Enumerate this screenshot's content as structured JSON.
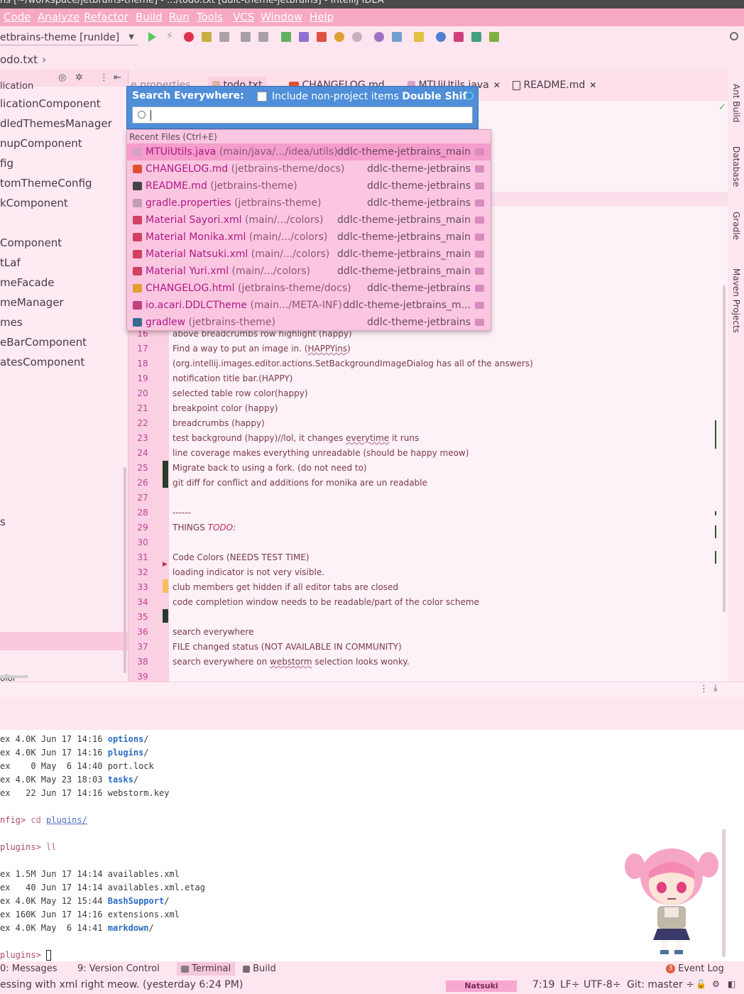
{
  "window": {
    "title": "ns [~/workspace/jetbrains-theme] - .../todo.txt [ddlc-theme-jetbrains] - IntelliJ IDEA"
  },
  "menu": [
    "Code",
    "Analyze",
    "Refactor",
    "Build",
    "Run",
    "Tools",
    "VCS",
    "Window",
    "Help"
  ],
  "toolbar": {
    "run_config": "etbrains-theme [runIde]"
  },
  "navbar": {
    "breadcrumb": "odo.txt"
  },
  "project_tree": {
    "items": [
      "lication",
      "licationComponent",
      "dledThemesManager",
      "nupComponent",
      "fig",
      "tomThemeConfig",
      "kComponent",
      "Component",
      "tLaf",
      "meFacade",
      "meManager",
      "mes",
      "eBarComponent",
      "atesComponent",
      "s",
      "olor"
    ]
  },
  "editor_tabs": [
    {
      "label": "e.properties"
    },
    {
      "label": "todo.txt"
    },
    {
      "label": "CHANGELOG.md"
    },
    {
      "label": "MTUiUtils.java"
    },
    {
      "label": "README.md"
    }
  ],
  "editor": {
    "lines": [
      {
        "n": "16",
        "text": "above breadcrumbs row highlight (happy)"
      },
      {
        "n": "17",
        "text": "Find a way to put an image in. (HAPPYins)"
      },
      {
        "n": "18",
        "text": "(org.intellij.images.editor.actions.SetBackgroundImageDialog has all of the answers)"
      },
      {
        "n": "19",
        "text": "notification title bar.(HAPPY)"
      },
      {
        "n": "20",
        "text": "selected table row color(happy)"
      },
      {
        "n": "21",
        "text": "breakpoint color (happy)"
      },
      {
        "n": "22",
        "text": "breadcrumbs (happy)"
      },
      {
        "n": "23",
        "text": "test background (happy)//lol, it changes everytime it runs"
      },
      {
        "n": "24",
        "text": "line coverage makes everything unreadable (should be happy meow)"
      },
      {
        "n": "25",
        "text": "Migrate back to using a fork. (do not need to)"
      },
      {
        "n": "26",
        "text": "git diff for conflict and additions for monika are un readable"
      },
      {
        "n": "27",
        "text": ""
      },
      {
        "n": "28",
        "text": "------"
      },
      {
        "n": "29",
        "text": "THINGS TODO:"
      },
      {
        "n": "30",
        "text": ""
      },
      {
        "n": "31",
        "text": "Code Colors (NEEDS TEST TIME)"
      },
      {
        "n": "32",
        "text": "loading indicator is not very visible."
      },
      {
        "n": "33",
        "text": "club members get hidden if all editor tabs are closed"
      },
      {
        "n": "34",
        "text": "code completion window needs to be readable/part of the color scheme"
      },
      {
        "n": "35",
        "text": ""
      },
      {
        "n": "36",
        "text": "search everywhere"
      },
      {
        "n": "37",
        "text": "FILE changed status (NOT AVAILABLE IN COMMUNITY)"
      },
      {
        "n": "38",
        "text": "search everywhere on webstorm selection looks wonky."
      },
      {
        "n": "39",
        "text": ""
      }
    ]
  },
  "right_tool_windows": [
    "Ant Build",
    "Database",
    "Gradle",
    "Maven Projects"
  ],
  "search_everywhere": {
    "title": "Search Everywhere:",
    "checkbox_label": "Include non-project items",
    "shortcut": "Double Shift",
    "query": "",
    "recent_header": "Recent Files (Ctrl+E)",
    "items": [
      {
        "name": "MTUiUtils.java",
        "loc": "(main/java/.../idea/utils)",
        "project": "ddlc-theme-jetbrains_main",
        "icon_color": "#d9a0c8"
      },
      {
        "name": "CHANGELOG.md",
        "loc": "(jetbrains-theme/docs)",
        "project": "ddlc-theme-jetbrains",
        "icon_color": "#e05030"
      },
      {
        "name": "README.md",
        "loc": "(jetbrains-theme)",
        "project": "ddlc-theme-jetbrains",
        "icon_color": "#444444"
      },
      {
        "name": "gradle.properties",
        "loc": "(jetbrains-theme)",
        "project": "ddlc-theme-jetbrains",
        "icon_color": "#c0a0b0"
      },
      {
        "name": "Material Sayori.xml",
        "loc": "(main/.../colors)",
        "project": "ddlc-theme-jetbrains_main",
        "icon_color": "#d04060"
      },
      {
        "name": "Material Monika.xml",
        "loc": "(main/.../colors)",
        "project": "ddlc-theme-jetbrains_main",
        "icon_color": "#d04060"
      },
      {
        "name": "Material Natsuki.xml",
        "loc": "(main/.../colors)",
        "project": "ddlc-theme-jetbrains_main",
        "icon_color": "#d04060"
      },
      {
        "name": "Material Yuri.xml",
        "loc": "(main/.../colors)",
        "project": "ddlc-theme-jetbrains_main",
        "icon_color": "#d04060"
      },
      {
        "name": "CHANGELOG.html",
        "loc": "(jetbrains-theme/docs)",
        "project": "ddlc-theme-jetbrains",
        "icon_color": "#e0a030"
      },
      {
        "name": "io.acari.DDLCTheme",
        "loc": "(main.../META-INF)",
        "project": "ddlc-theme-jetbrains_m...",
        "icon_color": "#c04080"
      },
      {
        "name": "gradlew",
        "loc": "(jetbrains-theme)",
        "project": "ddlc-theme-jetbrains",
        "icon_color": "#3a6a90"
      }
    ]
  },
  "terminal": {
    "lines": [
      {
        "pre": "ex 4.0K Jun 17 14:16 ",
        "dir": "options",
        "post": "/"
      },
      {
        "pre": "ex 4.0K Jun 17 14:16 ",
        "dir": "plugins",
        "post": "/"
      },
      {
        "pre": "ex    0 May  6 14:40 port.lock",
        "dir": "",
        "post": ""
      },
      {
        "pre": "ex 4.0K May 23 18:03 ",
        "dir": "tasks",
        "post": "/"
      },
      {
        "pre": "ex   22 Jun 17 14:16 webstorm.key",
        "dir": "",
        "post": ""
      },
      {
        "pre": "",
        "dir": "",
        "post": ""
      },
      {
        "pre": "nfig> cd plugins/",
        "dir": "",
        "post": ""
      },
      {
        "pre": "",
        "dir": "",
        "post": ""
      },
      {
        "pre": "plugins> ll",
        "dir": "",
        "post": ""
      },
      {
        "pre": "",
        "dir": "",
        "post": ""
      },
      {
        "pre": "ex 1.5M Jun 17 14:14 availables.xml",
        "dir": "",
        "post": ""
      },
      {
        "pre": "ex   40 Jun 17 14:14 availables.xml.etag",
        "dir": "",
        "post": ""
      },
      {
        "pre": "ex 4.0K May 12 15:44 ",
        "dir": "BashSupport",
        "post": "/"
      },
      {
        "pre": "ex 160K Jun 17 14:16 extensions.xml",
        "dir": "",
        "post": ""
      },
      {
        "pre": "ex 4.0K May  6 14:41 ",
        "dir": "markdown",
        "post": "/"
      },
      {
        "pre": "",
        "dir": "",
        "post": ""
      },
      {
        "pre": "plugins> ",
        "dir": "",
        "post": ""
      }
    ]
  },
  "tool_windows": {
    "messages": "0: Messages",
    "version_control": "9: Version Control",
    "terminal": "Terminal",
    "build": "Build",
    "event_log": "Event Log",
    "event_count": "3"
  },
  "status": {
    "message": "essing with xml right meow. (yesterday 6:24 PM)",
    "theme": "Natsuki",
    "position": "7:19",
    "line_sep": "LF",
    "encoding": "UTF-8",
    "git": "Git: master"
  }
}
